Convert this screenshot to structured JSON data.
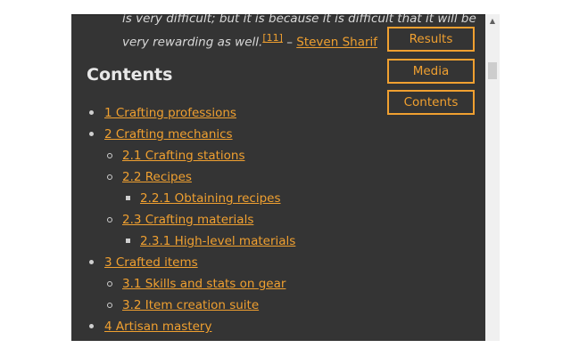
{
  "quote": {
    "line1": "is very difficult; but it is because it is difficult that it will be",
    "line2": "very rewarding as well.",
    "ref": "[11]",
    "dash": " – ",
    "author": "Steven Sharif"
  },
  "contents": {
    "heading": "Contents",
    "items": [
      {
        "label": "1 Crafting professions",
        "level": 1
      },
      {
        "label": "2 Crafting mechanics",
        "level": 1
      },
      {
        "label": "2.1 Crafting stations",
        "level": 2
      },
      {
        "label": "2.2 Recipes",
        "level": 2
      },
      {
        "label": "2.2.1 Obtaining recipes",
        "level": 3
      },
      {
        "label": "2.3 Crafting materials",
        "level": 2
      },
      {
        "label": "2.3.1 High-level materials",
        "level": 3
      },
      {
        "label": "3 Crafted items",
        "level": 1
      },
      {
        "label": "3.1 Skills and stats on gear",
        "level": 2
      },
      {
        "label": "3.2 Item creation suite",
        "level": 2
      },
      {
        "label": "4 Artisan mastery",
        "level": 1
      }
    ]
  },
  "side_buttons": {
    "results": "Results",
    "media": "Media",
    "contents": "Contents"
  },
  "colors": {
    "background": "#343434",
    "accent": "#f0a030",
    "text": "#d8d8d8"
  },
  "scrollbar": {
    "up_icon": "triangle-up-icon"
  }
}
